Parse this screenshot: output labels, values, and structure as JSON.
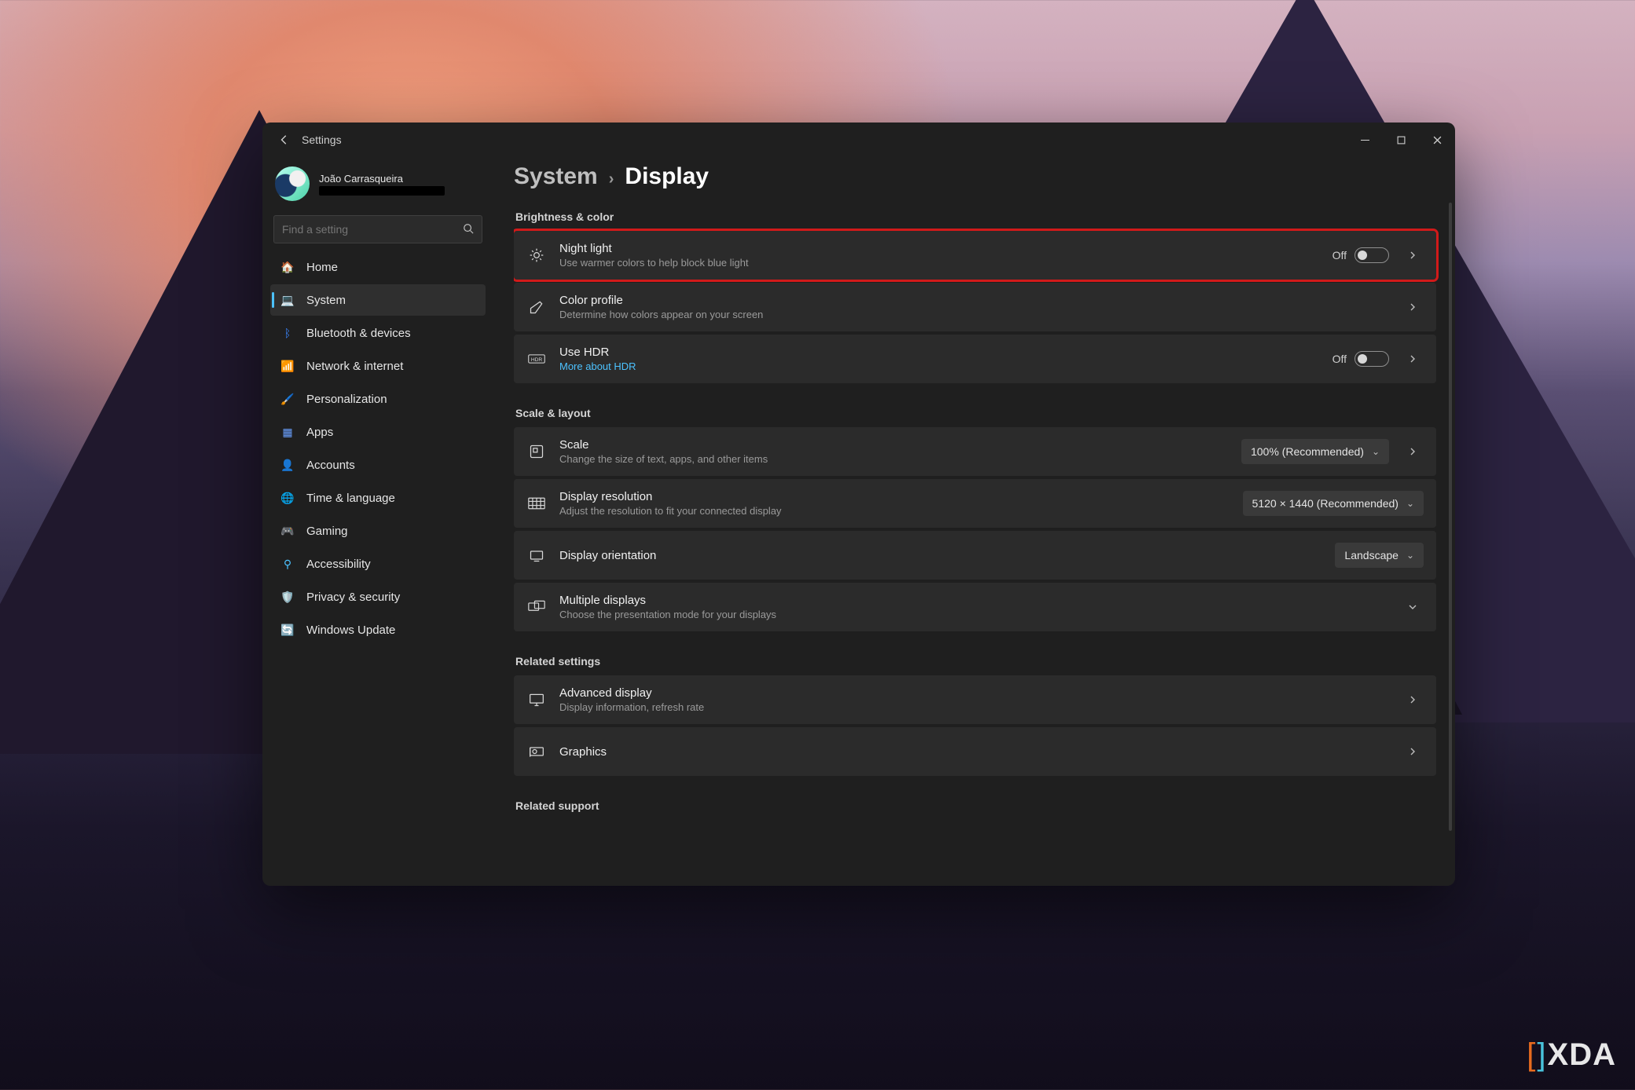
{
  "app": {
    "title": "Settings"
  },
  "account": {
    "name": "João Carrasqueira"
  },
  "search": {
    "placeholder": "Find a setting"
  },
  "sidebar": {
    "items": [
      {
        "id": "home",
        "label": "Home",
        "icon": "🏠",
        "color": "#f6a623"
      },
      {
        "id": "system",
        "label": "System",
        "icon": "💻",
        "color": "#4cc2ff",
        "active": true
      },
      {
        "id": "bt",
        "label": "Bluetooth & devices",
        "icon": "ᛒ",
        "color": "#3a86ff"
      },
      {
        "id": "net",
        "label": "Network & internet",
        "icon": "📶",
        "color": "#2ec4b6"
      },
      {
        "id": "pers",
        "label": "Personalization",
        "icon": "🖌️",
        "color": "#f48c06"
      },
      {
        "id": "apps",
        "label": "Apps",
        "icon": "▦",
        "color": "#6aa0ff"
      },
      {
        "id": "acc",
        "label": "Accounts",
        "icon": "👤",
        "color": "#2fe2a8"
      },
      {
        "id": "time",
        "label": "Time & language",
        "icon": "🌐",
        "color": "#4cc2ff"
      },
      {
        "id": "gaming",
        "label": "Gaming",
        "icon": "🎮",
        "color": "#9e9e9e"
      },
      {
        "id": "a11y",
        "label": "Accessibility",
        "icon": "⚲",
        "color": "#4cc2ff"
      },
      {
        "id": "priv",
        "label": "Privacy & security",
        "icon": "🛡️",
        "color": "#6f7d8d"
      },
      {
        "id": "wu",
        "label": "Windows Update",
        "icon": "🔄",
        "color": "#2874d8"
      }
    ]
  },
  "breadcrumb": {
    "parent": "System",
    "sep": "›",
    "here": "Display"
  },
  "sections": {
    "brightness": {
      "label": "Brightness & color",
      "rows": [
        {
          "id": "night-light",
          "title": "Night light",
          "desc": "Use warmer colors to help block blue light",
          "toggle": {
            "state": "Off"
          },
          "chevron": true,
          "highlight": true,
          "icon": "brightness"
        },
        {
          "id": "color-profile",
          "title": "Color profile",
          "desc": "Determine how colors appear on your screen",
          "chevron": true,
          "icon": "palette"
        },
        {
          "id": "hdr",
          "title": "Use HDR",
          "link": "More about HDR",
          "toggle": {
            "state": "Off"
          },
          "chevron": true,
          "icon": "hdr"
        }
      ]
    },
    "scale": {
      "label": "Scale & layout",
      "rows": [
        {
          "id": "scale",
          "title": "Scale",
          "desc": "Change the size of text, apps, and other items",
          "drop": "100% (Recommended)",
          "chevron": true,
          "icon": "scale"
        },
        {
          "id": "res",
          "title": "Display resolution",
          "desc": "Adjust the resolution to fit your connected display",
          "drop": "5120 × 1440 (Recommended)",
          "icon": "resolution"
        },
        {
          "id": "orient",
          "title": "Display orientation",
          "drop": "Landscape",
          "icon": "orientation"
        },
        {
          "id": "multi",
          "title": "Multiple displays",
          "desc": "Choose the presentation mode for your displays",
          "expand": true,
          "icon": "multi"
        }
      ]
    },
    "related": {
      "label": "Related settings",
      "rows": [
        {
          "id": "adv",
          "title": "Advanced display",
          "desc": "Display information, refresh rate",
          "chevron": true,
          "icon": "monitor"
        },
        {
          "id": "gfx",
          "title": "Graphics",
          "chevron": true,
          "icon": "gpu"
        }
      ]
    },
    "support": {
      "label": "Related support"
    }
  },
  "watermark": {
    "text": "XDA"
  }
}
